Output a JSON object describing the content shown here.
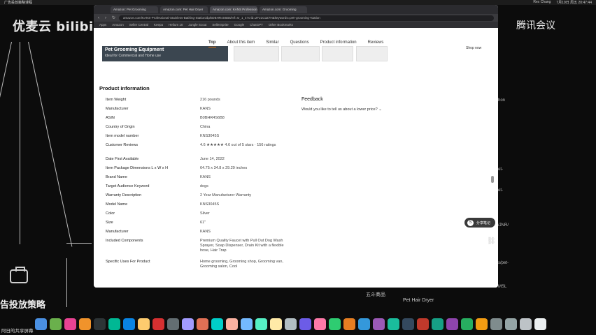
{
  "menubar": {
    "left": "广告投放策略课程",
    "right": [
      "Rex Chang",
      "7月19日 周五 20:47:44"
    ]
  },
  "watermarks": {
    "left": "优麦云 bilibili",
    "right": "腾讯会议",
    "bottom_left": "告投放策略",
    "bottom_caption": "阿日的共享屏幕"
  },
  "browser": {
    "tabs": [
      "Amazon: Pet Grooming",
      "Amazon.com: Pet Hair Dryer",
      "Amazon.com: KANS Professional",
      "Amazon.com: Grooming"
    ],
    "url": "amazon.com/KANS-Professional-Stainless-Bathing-Station/dp/B0BHR4S6B8/ref=sr_1_4?crid=2F21G3Z7H&keywords=pet+grooming+station",
    "bookmarks": [
      "Apps",
      "Amazon",
      "Seller Central",
      "Keepa",
      "Helium 10",
      "Jungle Scout",
      "SellerSprite",
      "Google",
      "ChatGPT",
      "Other Bookmarks"
    ]
  },
  "subnav": {
    "items": [
      "Top",
      "About this item",
      "Similar",
      "Questions",
      "Product information",
      "Reviews"
    ],
    "active_index": 0
  },
  "promo": {
    "title": "Pet Grooming Equipment",
    "subtitle": "Ideal for Commercial and Home use",
    "side_text": "Shop now"
  },
  "product_info": {
    "heading": "Product information",
    "rows": [
      {
        "k": "Item Weight",
        "v": "216 pounds"
      },
      {
        "k": "Manufacturer",
        "v": "KANS"
      },
      {
        "k": "ASIN",
        "v": "B0BHR4S6B8"
      },
      {
        "k": "Country of Origin",
        "v": "China"
      },
      {
        "k": "Item model number",
        "v": "KNS3045S"
      },
      {
        "k": "Customer Reviews",
        "v": "4.6 ★★★★★ 4.6 out of 5 stars · 156 ratings"
      },
      {
        "k": "Date First Available",
        "v": "June 14, 2022"
      },
      {
        "k": "Item Package Dimensions L x W x H",
        "v": "64.75 x 34.8 x 29.29 inches"
      },
      {
        "k": "Brand Name",
        "v": "KANS"
      },
      {
        "k": "Target Audience Keyword",
        "v": "dogs"
      },
      {
        "k": "Warranty Description",
        "v": "2 Year Manufacturer Warranty"
      },
      {
        "k": "Model Name",
        "v": "KNS3045S"
      },
      {
        "k": "Color",
        "v": "Silver"
      },
      {
        "k": "Size",
        "v": "61\""
      },
      {
        "k": "Manufacturer",
        "v": "KANS"
      },
      {
        "k": "Included Components",
        "v": "Premium Quality Faucet with Pull Out Dog Wash Sprayer, Soap Dispenser, Drain Kit with a flexible hose, Hair Trap"
      },
      {
        "k": "Specific Uses For Product",
        "v": "Home grooming, Grooming shop, Grooming van, Grooming salon, Cool"
      }
    ]
  },
  "feedback": {
    "title": "Feedback",
    "question": "Would you like to tell us about a lower price? ⌄"
  },
  "float_button": {
    "label": "分享笔记"
  },
  "background_right": [
    "hon",
    "et-",
    "et-",
    "/JNR/",
    "s/pet-",
    "MSL"
  ],
  "background_bottom": [
    "五斗商品",
    "Pet Hair Dryer"
  ]
}
